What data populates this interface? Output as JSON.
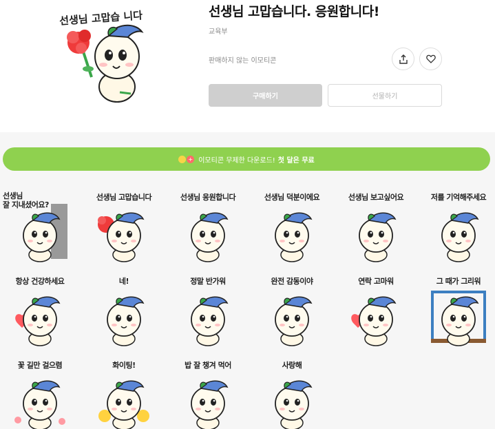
{
  "header": {
    "title": "선생님 고맙습니다. 응원합니다!",
    "author": "교육부",
    "not_for_sale": "판매하지 않는 이모티콘",
    "buy_label": "구매하기",
    "gift_label": "선물하기",
    "hero_caption": "선생님 고맙습 니다"
  },
  "promo": {
    "text": "이모티콘 무제한 다운로드!",
    "highlight": "첫 달은 무료",
    "badge": "+"
  },
  "stickers": [
    {
      "caption": "선생님 잘 지내셨어요?",
      "line1": "선생님",
      "line2": "잘 지내셨어요?"
    },
    {
      "caption": "선생님 고맙습니다"
    },
    {
      "caption": "선생님 응원합니다"
    },
    {
      "caption": "선생님 덕분이에요"
    },
    {
      "caption": "선생님 보고싶어요"
    },
    {
      "caption": "저를 기억해주세요"
    },
    {
      "caption": "항상 건강하세요"
    },
    {
      "caption": "네!"
    },
    {
      "caption": "정말 반가워"
    },
    {
      "caption": "완전 감동이야"
    },
    {
      "caption": "연락 고마워"
    },
    {
      "caption": "그 때가 그리워"
    },
    {
      "caption": "꽃 길만 걸으렴"
    },
    {
      "caption": "화이팅!"
    },
    {
      "caption": "밥 잘 챙겨 먹어"
    },
    {
      "caption": "사랑해"
    }
  ],
  "colors": {
    "promo_green": "#8fd14f",
    "button_grey": "#cfcfcf",
    "leaf_blue": "#5b86d6",
    "leaf_green": "#3aa64a",
    "heart_red": "#ff5a5f"
  },
  "icons": {
    "share": "share-icon",
    "like": "heart-outline-icon"
  }
}
